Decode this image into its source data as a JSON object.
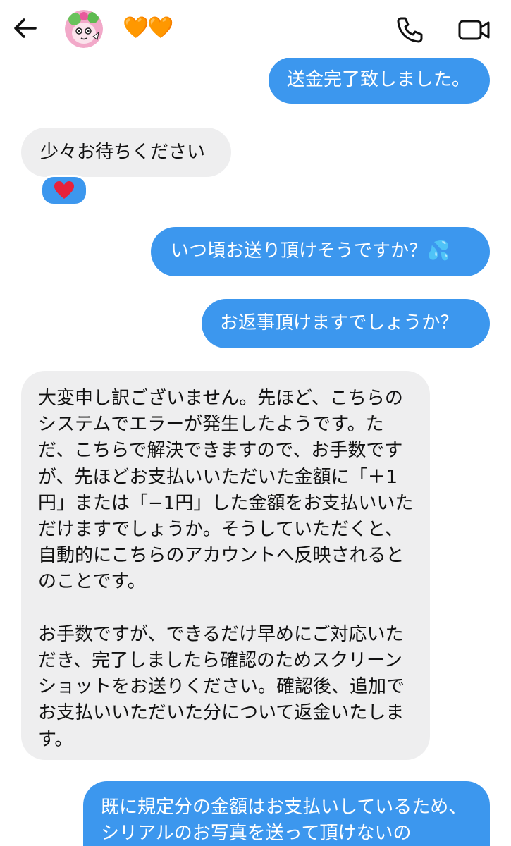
{
  "header": {
    "contact_name": "🧡🧡",
    "avatar_icon": "cartoon-character-avatar",
    "back_icon": "arrow-left-icon",
    "call_icon": "phone-icon",
    "video_icon": "video-camera-icon"
  },
  "colors": {
    "sent_bubble": "#3c97ee",
    "received_bubble": "#eeeeef",
    "header_icon": "#111111"
  },
  "messages": [
    {
      "direction": "sent",
      "text": "送金完了致しました。"
    },
    {
      "direction": "received",
      "text": "少々お待ちください",
      "reaction": "heart"
    },
    {
      "direction": "sent",
      "text": "いつ頃お送り頂けそうですか？💦"
    },
    {
      "direction": "sent",
      "text": "お返事頂けますでしょうか？"
    },
    {
      "direction": "received",
      "text": "大変申し訳ございません。先ほど、こちらのシステムでエラーが発生したようです。ただ、こちらで解決できますので、お手数ですが、先ほどお支払いいただいた金額に「＋1円」または「−1円」した金額をお支払いいただけますでしょうか。そうしていただくと、自動的にこちらのアカウントへ反映されるとのことです。\n\nお手数ですが、できるだけ早めにご対応いただき、完了しましたら確認のためスクリーンショットをお送りください。確認後、追加でお支払いいただいた分について返金いたします。"
    },
    {
      "direction": "sent",
      "text": "既に規定分の金額はお支払いしているため、シリアルのお写真を送って頂けないの"
    }
  ]
}
